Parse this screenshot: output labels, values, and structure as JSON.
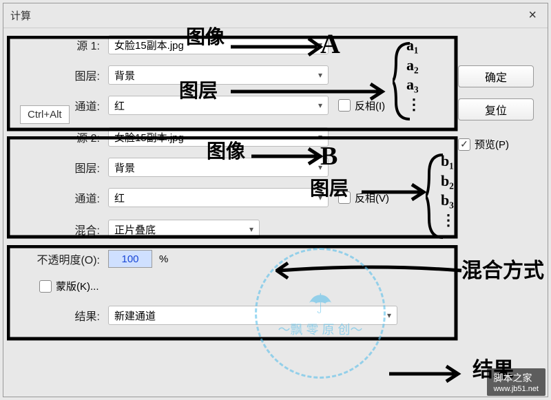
{
  "window": {
    "title": "计算",
    "close": "×"
  },
  "tooltip": "Ctrl+Alt",
  "source1": {
    "label": "源 1:",
    "value": "女脸15副本.jpg",
    "layer_label": "图层:",
    "layer_value": "背景",
    "channel_label": "通道:",
    "channel_value": "红",
    "invert_label": "反相(I)"
  },
  "source2": {
    "label": "源 2:",
    "value": "女脸15副本.jpg",
    "layer_label": "图层:",
    "layer_value": "背景",
    "channel_label": "通道:",
    "channel_value": "红",
    "invert_label": "反相(V)"
  },
  "blend": {
    "label": "混合:",
    "value": "正片叠底",
    "opacity_label": "不透明度(O):",
    "opacity_value": "100",
    "pct": "%",
    "mask_label": "蒙版(K)..."
  },
  "result": {
    "label": "结果:",
    "value": "新建通道"
  },
  "buttons": {
    "ok": "确定",
    "reset": "复位",
    "preview": "预览(P)"
  },
  "annotations": {
    "img1": "图像",
    "A": "A",
    "brace1": "a₁\na₂\na₃\n⋮",
    "layer1": "图层",
    "img2": "图像",
    "B": "B",
    "layer2": "图层",
    "brace2": "b₁\nb₂\nb₃\n⋮",
    "blendmode": "混合方式",
    "result": "结果"
  },
  "watermark": {
    "text": "～飘 零 原 创～"
  },
  "footer": {
    "brand": "脚本之家",
    "url": "www.jb51.net"
  }
}
